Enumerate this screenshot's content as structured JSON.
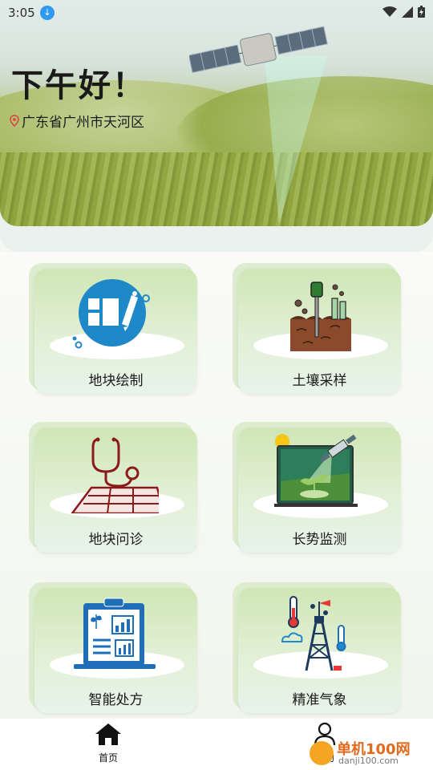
{
  "status_bar": {
    "time": "3:05"
  },
  "header": {
    "greeting": "下午好！",
    "location": "广东省广州市天河区"
  },
  "grid": [
    {
      "label": "地块绘制",
      "icon": "plot-draw-icon"
    },
    {
      "label": "土壤采样",
      "icon": "soil-sample-icon"
    },
    {
      "label": "地块问诊",
      "icon": "plot-diagnosis-icon"
    },
    {
      "label": "长势监测",
      "icon": "growth-monitor-icon"
    },
    {
      "label": "智能处方",
      "icon": "smart-prescription-icon"
    },
    {
      "label": "精准气象",
      "icon": "weather-icon"
    }
  ],
  "nav": {
    "home": "首页",
    "mine": "我的"
  },
  "watermark": {
    "title": "单机100网",
    "url": "danji100.com"
  },
  "colors": {
    "card_green": "#cfe6b6",
    "accent_blue": "#1e88c9",
    "soil_brown": "#8b4a2b"
  }
}
